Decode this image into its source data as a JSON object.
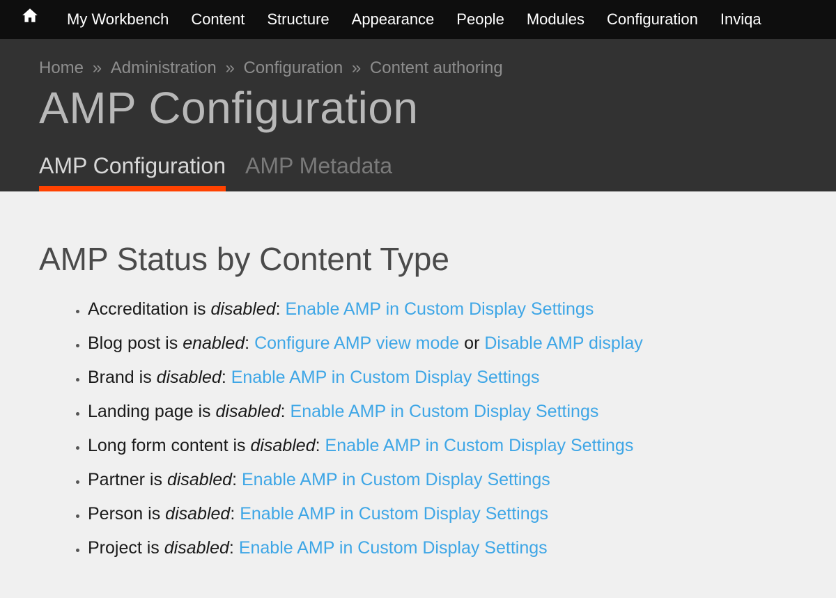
{
  "nav": {
    "items": [
      "My Workbench",
      "Content",
      "Structure",
      "Appearance",
      "People",
      "Modules",
      "Configuration",
      "Inviqa"
    ]
  },
  "breadcrumb": {
    "items": [
      "Home",
      "Administration",
      "Configuration",
      "Content authoring"
    ],
    "sep": "»"
  },
  "page": {
    "title": "AMP Configuration"
  },
  "tabs": {
    "items": [
      {
        "label": "AMP Configuration",
        "active": true
      },
      {
        "label": "AMP Metadata",
        "active": false
      }
    ]
  },
  "section": {
    "heading": "AMP Status by Content Type"
  },
  "link_text": {
    "enable": "Enable AMP in Custom Display Settings",
    "configure": "Configure AMP view mode",
    "disable": "Disable AMP display",
    "or": "or"
  },
  "content_types": [
    {
      "name": "Accreditation",
      "state": "disabled",
      "actions": [
        "enable"
      ]
    },
    {
      "name": "Blog post",
      "state": "enabled",
      "actions": [
        "configure",
        "disable"
      ]
    },
    {
      "name": "Brand",
      "state": "disabled",
      "actions": [
        "enable"
      ]
    },
    {
      "name": "Landing page",
      "state": "disabled",
      "actions": [
        "enable"
      ]
    },
    {
      "name": "Long form content",
      "state": "disabled",
      "actions": [
        "enable"
      ]
    },
    {
      "name": "Partner",
      "state": "disabled",
      "actions": [
        "enable"
      ]
    },
    {
      "name": "Person",
      "state": "disabled",
      "actions": [
        "enable"
      ]
    },
    {
      "name": "Project",
      "state": "disabled",
      "actions": [
        "enable"
      ]
    }
  ]
}
